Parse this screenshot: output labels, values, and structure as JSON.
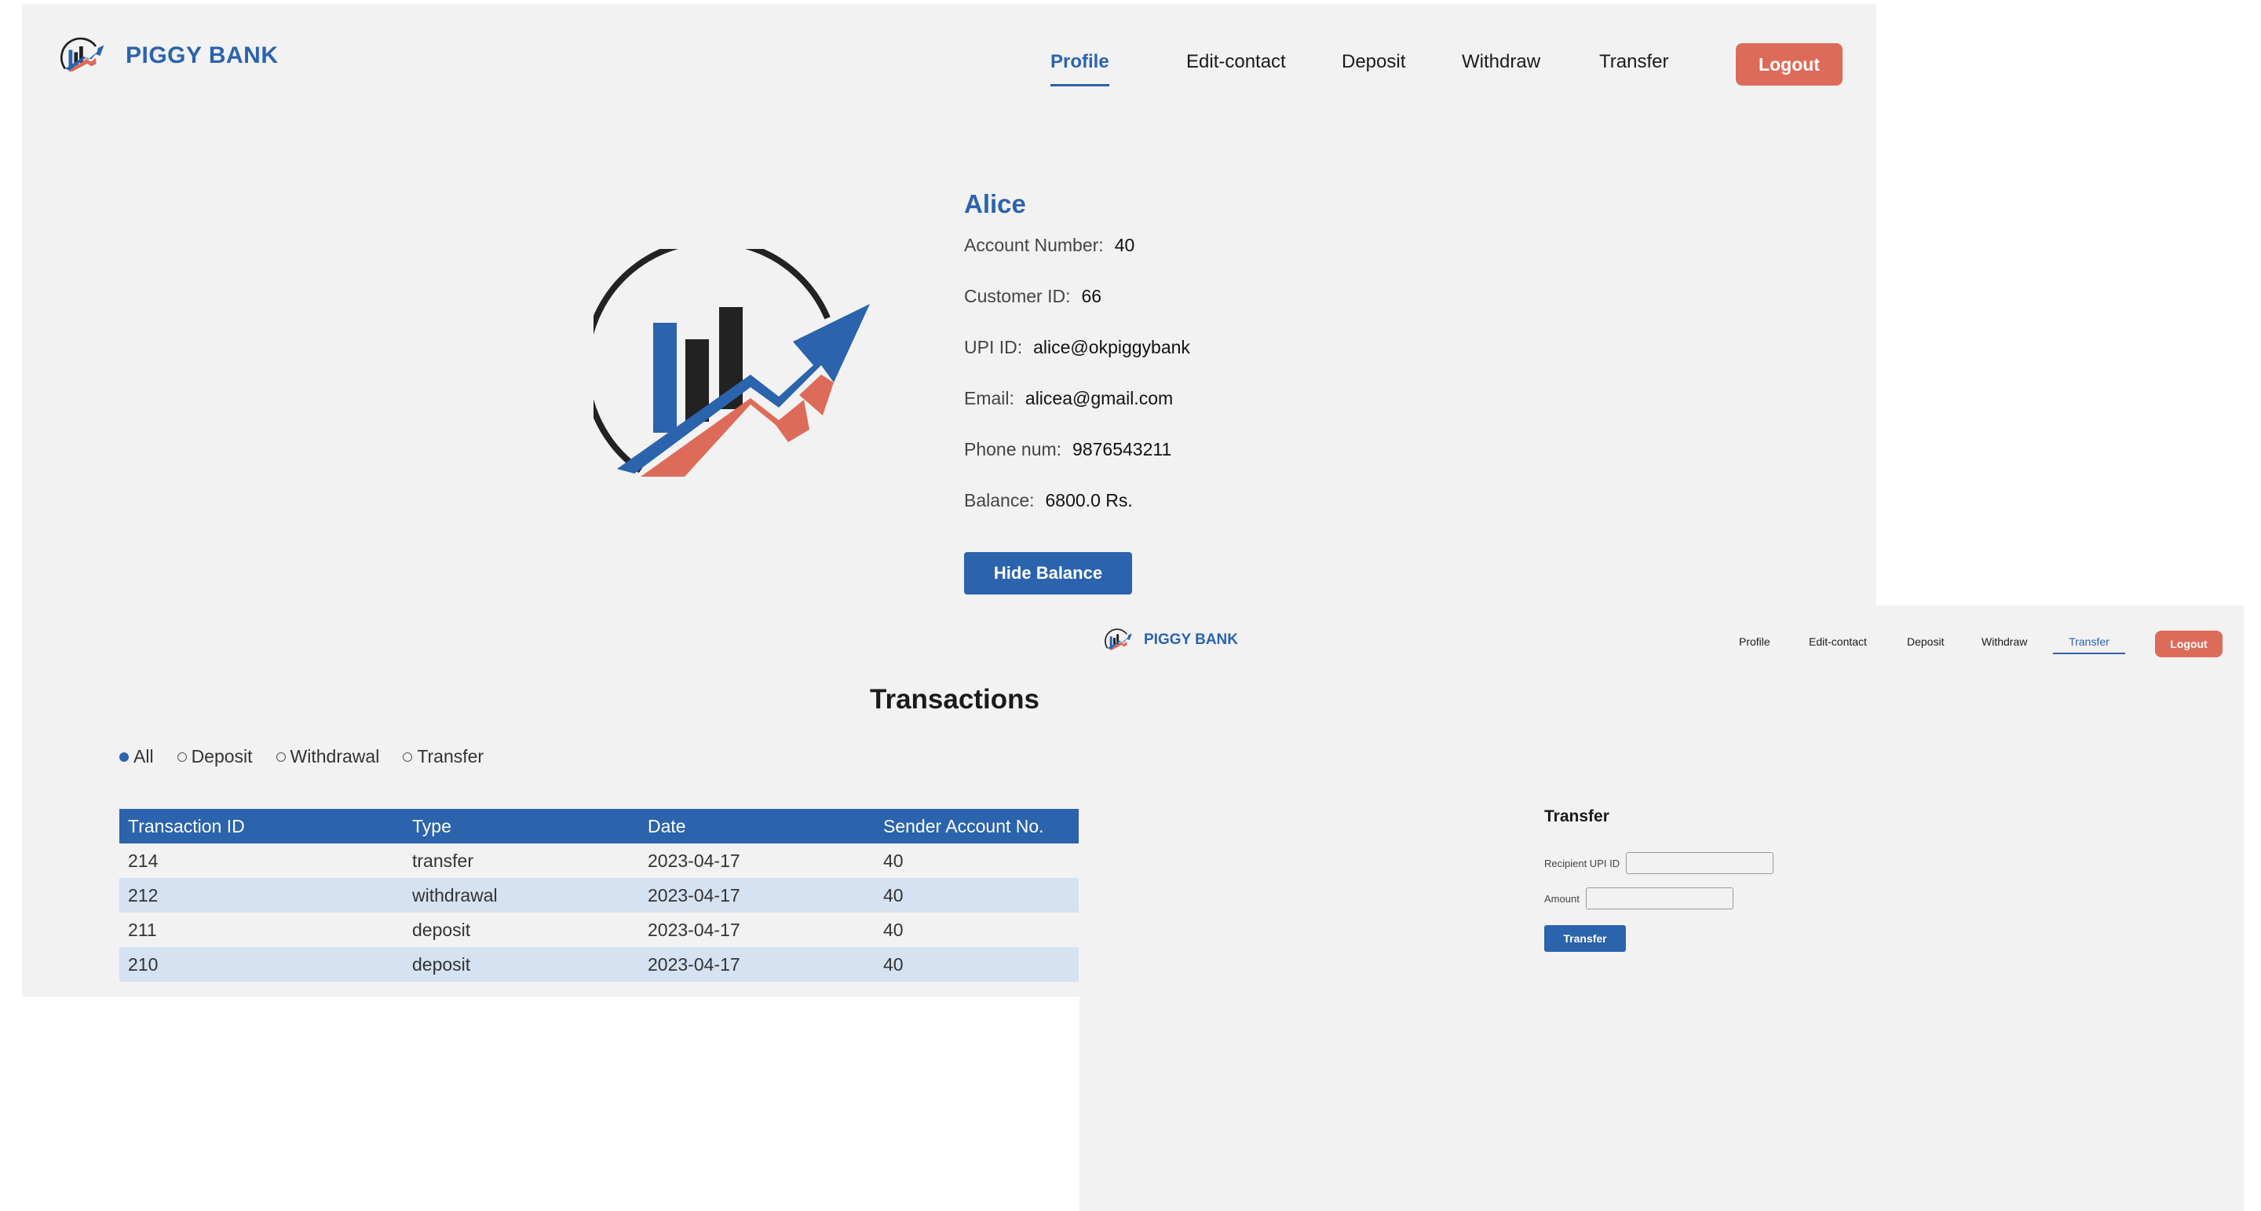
{
  "profile_window": {
    "brand": "PIGGY BANK",
    "nav": {
      "profile": "Profile",
      "edit_contact": "Edit-contact",
      "deposit": "Deposit",
      "withdraw": "Withdraw",
      "transfer": "Transfer",
      "active": "Profile"
    },
    "logout_label": "Logout",
    "user": {
      "name": "Alice",
      "account_number_label": "Account Number:",
      "account_number": "40",
      "customer_id_label": "Customer ID:",
      "customer_id": "66",
      "upi_id_label": "UPI ID:",
      "upi_id": "alice@okpiggybank",
      "email_label": "Email:",
      "email": "alicea@gmail.com",
      "phone_label": "Phone num:",
      "phone": "9876543211",
      "balance_label": "Balance:",
      "balance": "6800.0 Rs."
    },
    "hide_balance_label": "Hide Balance",
    "transactions": {
      "title": "Transactions",
      "filters": [
        "All",
        "Deposit",
        "Withdrawal",
        "Transfer"
      ],
      "selected_filter": "All",
      "columns": [
        "Transaction ID",
        "Type",
        "Date",
        "Sender Account No."
      ],
      "rows": [
        [
          "214",
          "transfer",
          "2023-04-17",
          "40"
        ],
        [
          "212",
          "withdrawal",
          "2023-04-17",
          "40"
        ],
        [
          "211",
          "deposit",
          "2023-04-17",
          "40"
        ],
        [
          "210",
          "deposit",
          "2023-04-17",
          "40"
        ]
      ]
    }
  },
  "transfer_window": {
    "brand": "PIGGY BANK",
    "nav": {
      "profile": "Profile",
      "edit_contact": "Edit-contact",
      "deposit": "Deposit",
      "withdraw": "Withdraw",
      "transfer": "Transfer",
      "active": "Transfer"
    },
    "logout_label": "Logout",
    "form": {
      "title": "Transfer",
      "recipient_label": "Recipient UPI ID",
      "recipient_value": "",
      "amount_label": "Amount",
      "amount_value": "",
      "submit_label": "Transfer"
    }
  },
  "colors": {
    "brand_blue": "#2b63ad",
    "logout_red": "#dd6b59",
    "logo_orange": "#dd6b59",
    "logo_dark": "#222222",
    "row_alt": "#d4e2f1",
    "page_bg": "#f2f2f2"
  },
  "icons": {
    "brand_logo": "chart-growth-arrow-logo"
  }
}
